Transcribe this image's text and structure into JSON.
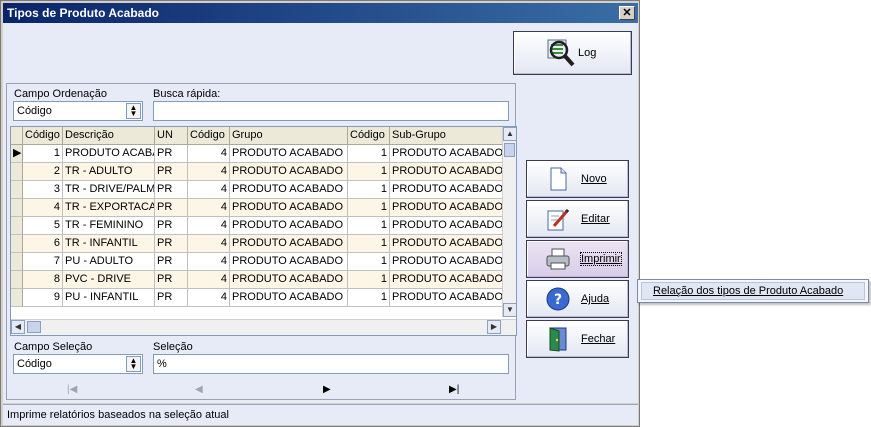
{
  "window": {
    "title": "Tipos de Produto Acabado",
    "close_glyph": "✕"
  },
  "buttons": {
    "log": "Log",
    "novo": "Novo",
    "editar": "Editar",
    "imprimir": "Imprimir",
    "ajuda": "Ajuda",
    "fechar": "Fechar"
  },
  "filter": {
    "campo_ordenacao_label": "Campo Ordenação",
    "campo_ordenacao_value": "Código",
    "busca_rapida_label": "Busca rápida:",
    "busca_rapida_value": ""
  },
  "grid": {
    "columns": [
      "Código",
      "Descrição",
      "UN",
      "Código",
      "Grupo",
      "Código",
      "Sub-Grupo"
    ],
    "rows": [
      [
        "1",
        "PRODUTO ACABADO",
        "PR",
        "4",
        "PRODUTO ACABADO",
        "1",
        "PRODUTO ACABADO"
      ],
      [
        "2",
        "TR - ADULTO",
        "PR",
        "4",
        "PRODUTO ACABADO",
        "1",
        "PRODUTO ACABADO"
      ],
      [
        "3",
        "TR - DRIVE/PALM",
        "PR",
        "4",
        "PRODUTO ACABADO",
        "1",
        "PRODUTO ACABADO"
      ],
      [
        "4",
        "TR - EXPORTACAO",
        "PR",
        "4",
        "PRODUTO ACABADO",
        "1",
        "PRODUTO ACABADO"
      ],
      [
        "5",
        "TR - FEMININO",
        "PR",
        "4",
        "PRODUTO ACABADO",
        "1",
        "PRODUTO ACABADO"
      ],
      [
        "6",
        "TR - INFANTIL",
        "PR",
        "4",
        "PRODUTO ACABADO",
        "1",
        "PRODUTO ACABADO"
      ],
      [
        "7",
        "PU - ADULTO",
        "PR",
        "4",
        "PRODUTO ACABADO",
        "1",
        "PRODUTO ACABADO"
      ],
      [
        "8",
        "PVC - DRIVE",
        "PR",
        "4",
        "PRODUTO ACABADO",
        "1",
        "PRODUTO ACABADO"
      ],
      [
        "9",
        "PU - INFANTIL",
        "PR",
        "4",
        "PRODUTO ACABADO",
        "1",
        "PRODUTO ACABADO"
      ]
    ]
  },
  "selection": {
    "campo_selecao_label": "Campo Seleção",
    "campo_selecao_value": "Código",
    "selecao_label": "Seleção",
    "selecao_value": "%"
  },
  "navigator": {
    "first": "|◀",
    "prior": "◀",
    "next": "▶",
    "last": "▶|"
  },
  "status": {
    "text": "Imprime relatórios baseados na seleção atual"
  },
  "popup_menu": {
    "item": "Relação dos tipos de Produto Acabado"
  },
  "icons": {
    "log": "magnifier-icon",
    "novo": "new-document-icon",
    "editar": "edit-pen-icon",
    "imprimir": "printer-icon",
    "ajuda": "help-icon",
    "fechar": "exit-door-icon"
  }
}
